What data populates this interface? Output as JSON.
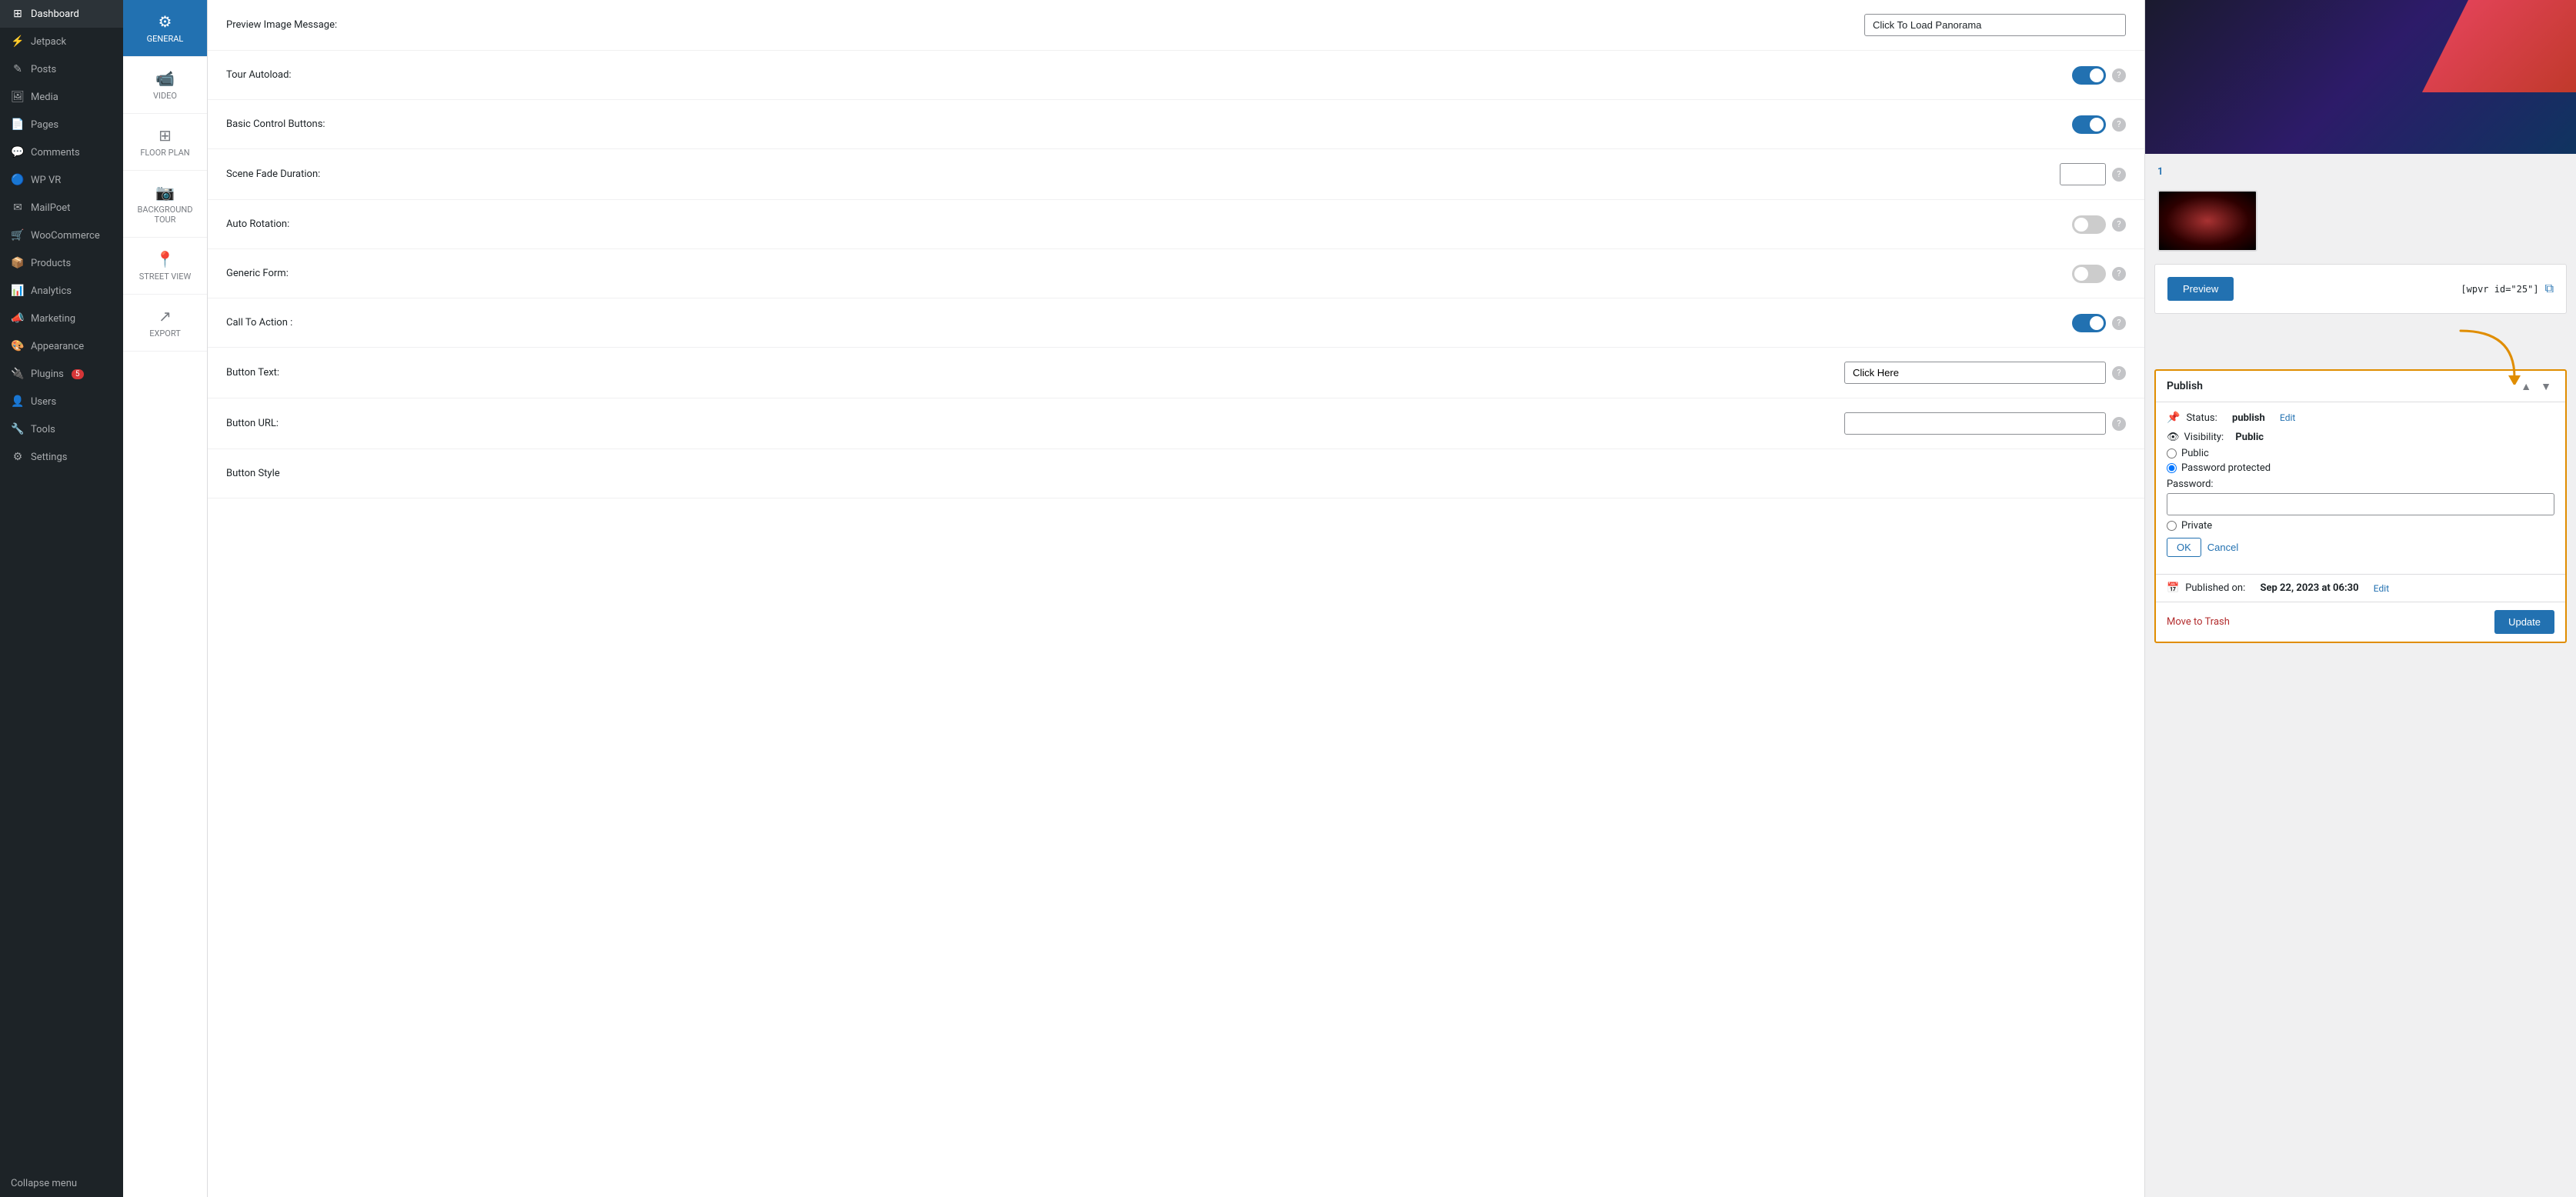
{
  "sidebar": {
    "items": [
      {
        "id": "dashboard",
        "label": "Dashboard",
        "icon": "⊞"
      },
      {
        "id": "jetpack",
        "label": "Jetpack",
        "icon": "⚡"
      },
      {
        "id": "posts",
        "label": "Posts",
        "icon": "✎"
      },
      {
        "id": "media",
        "label": "Media",
        "icon": "⊞"
      },
      {
        "id": "pages",
        "label": "Pages",
        "icon": "📄"
      },
      {
        "id": "comments",
        "label": "Comments",
        "icon": "💬"
      },
      {
        "id": "wp-vr",
        "label": "WP VR",
        "icon": "🔵"
      },
      {
        "id": "mailpoet",
        "label": "MailPoet",
        "icon": "✉"
      },
      {
        "id": "woocommerce",
        "label": "WooCommerce",
        "icon": "🛒"
      },
      {
        "id": "products",
        "label": "Products",
        "icon": "📦"
      },
      {
        "id": "analytics",
        "label": "Analytics",
        "icon": "📊"
      },
      {
        "id": "marketing",
        "label": "Marketing",
        "icon": "📣"
      },
      {
        "id": "appearance",
        "label": "Appearance",
        "icon": "🎨"
      },
      {
        "id": "plugins",
        "label": "Plugins",
        "icon": "🔌",
        "badge": "5"
      },
      {
        "id": "users",
        "label": "Users",
        "icon": "👤"
      },
      {
        "id": "tools",
        "label": "Tools",
        "icon": "🔧"
      },
      {
        "id": "settings",
        "label": "Settings",
        "icon": "⚙"
      }
    ],
    "collapse_label": "Collapse menu"
  },
  "subnav": {
    "items": [
      {
        "id": "general",
        "label": "GENERAL",
        "icon": "⚙",
        "active": true
      },
      {
        "id": "video",
        "label": "VIDEO",
        "icon": "📹"
      },
      {
        "id": "floor-plan",
        "label": "FLOOR PLAN",
        "icon": "⊞"
      },
      {
        "id": "background-tour",
        "label": "BACKGROUND TOUR",
        "icon": "📷"
      },
      {
        "id": "street-view",
        "label": "STREET VIEW",
        "icon": "📍"
      },
      {
        "id": "export",
        "label": "EXPORT",
        "icon": "↗"
      }
    ]
  },
  "settings": {
    "rows": [
      {
        "id": "preview-image-message",
        "label": "Preview Image Message:",
        "type": "text",
        "value": "Click To Load Panorama",
        "input_size": "large"
      },
      {
        "id": "tour-autoload",
        "label": "Tour Autoload:",
        "type": "toggle",
        "checked": true
      },
      {
        "id": "basic-control-buttons",
        "label": "Basic Control Buttons:",
        "type": "toggle",
        "checked": true
      },
      {
        "id": "scene-fade-duration",
        "label": "Scene Fade Duration:",
        "type": "text-sm",
        "value": ""
      },
      {
        "id": "auto-rotation",
        "label": "Auto Rotation:",
        "type": "toggle",
        "checked": false
      },
      {
        "id": "generic-form",
        "label": "Generic Form:",
        "type": "toggle",
        "checked": false
      },
      {
        "id": "call-to-action",
        "label": "Call To Action :",
        "type": "toggle",
        "checked": true
      },
      {
        "id": "button-text",
        "label": "Button Text:",
        "type": "text",
        "value": "Click Here",
        "input_size": "medium"
      },
      {
        "id": "button-url",
        "label": "Button URL:",
        "type": "text",
        "value": "",
        "input_size": "medium"
      },
      {
        "id": "button-style",
        "label": "Button Style",
        "type": "none"
      }
    ]
  },
  "right_panel": {
    "scene_number": "1",
    "preview_button": "Preview",
    "shortcode": "[wpvr id=\"25\"]",
    "copy_tooltip": "Copy shortcode",
    "publish": {
      "title": "Publish",
      "status_label": "Status:",
      "status_value": "publish",
      "status_edit": "Edit",
      "visibility_label": "Visibility:",
      "visibility_value": "Public",
      "radio_options": [
        {
          "id": "public",
          "label": "Public",
          "checked": false
        },
        {
          "id": "password-protected",
          "label": "Password protected",
          "checked": true
        },
        {
          "id": "private",
          "label": "Private",
          "checked": false
        }
      ],
      "password_label": "Password:",
      "password_value": "",
      "ok_label": "OK",
      "cancel_label": "Cancel",
      "published_on_label": "Published on:",
      "published_on_value": "Sep 22, 2023 at 06:30",
      "published_edit": "Edit",
      "move_to_trash": "Move to Trash",
      "update_label": "Update"
    }
  }
}
